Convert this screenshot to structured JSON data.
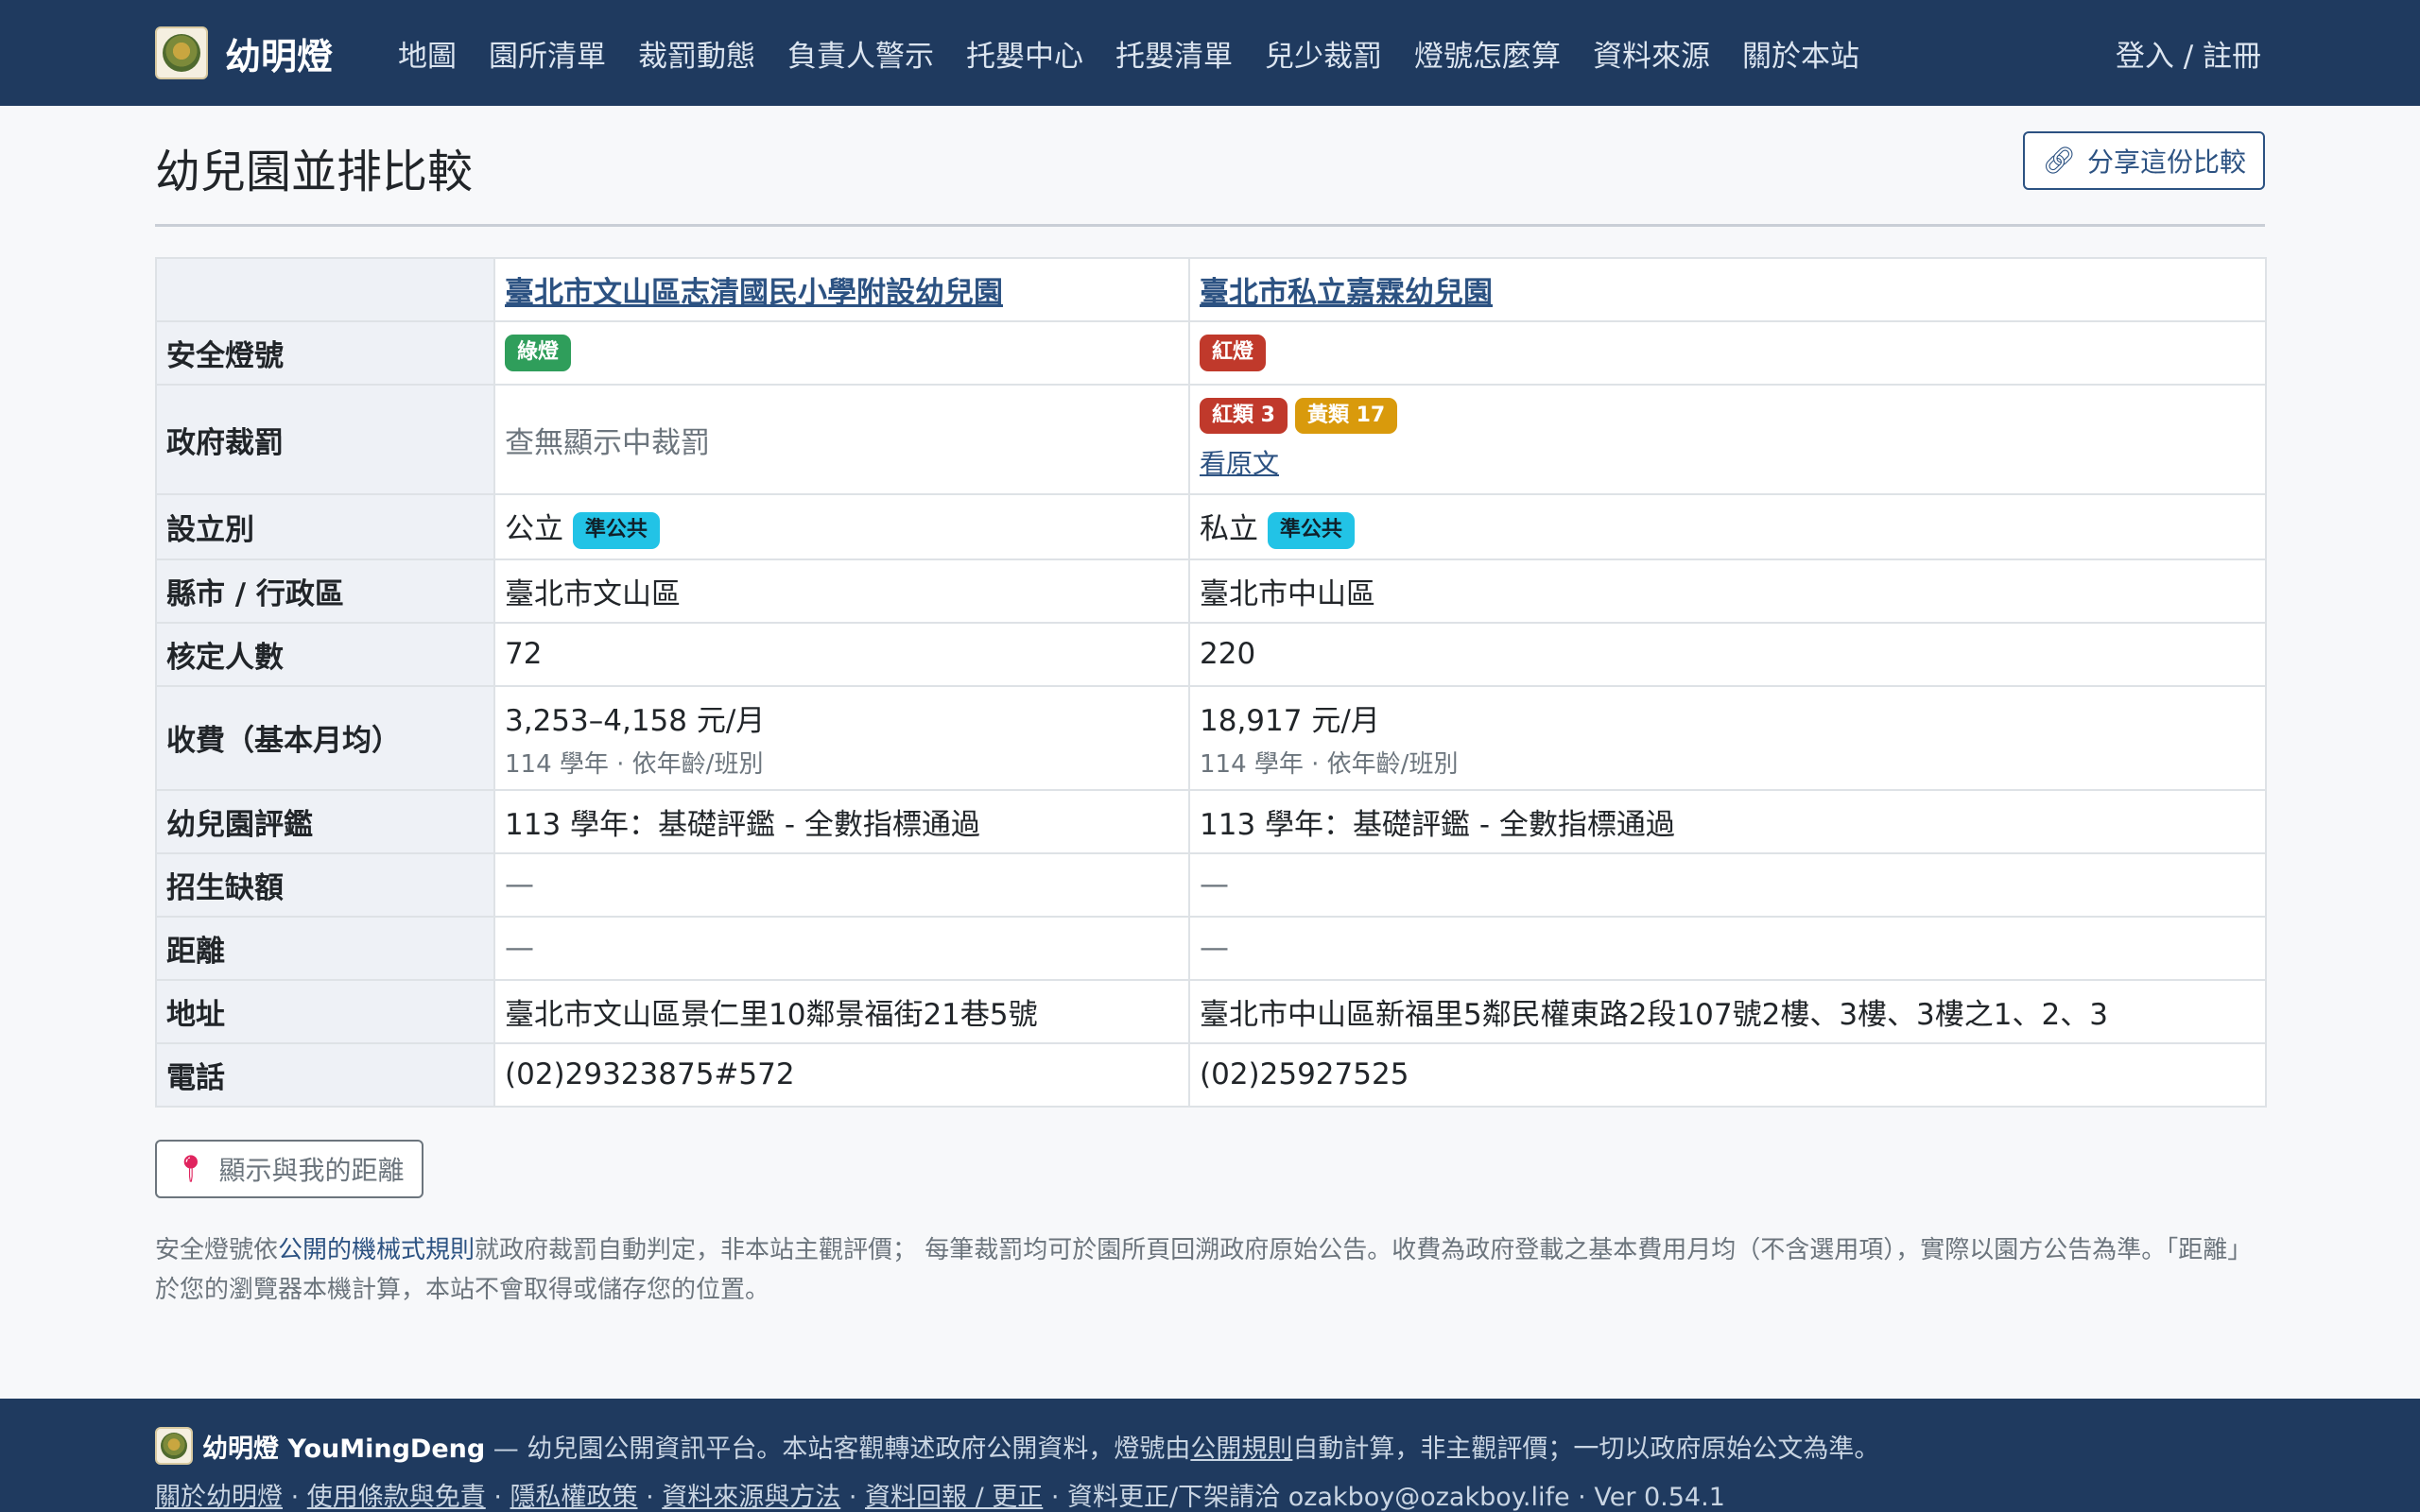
{
  "nav": {
    "brand": "幼明燈",
    "links": [
      "地圖",
      "園所清單",
      "裁罰動態",
      "負責人警示",
      "托嬰中心",
      "托嬰清單",
      "兒少裁罰",
      "燈號怎麼算",
      "資料來源",
      "關於本站"
    ],
    "auth": "登入 / 註冊"
  },
  "page": {
    "title": "幼兒園並排比較",
    "share_label": "分享這份比較",
    "share_icon": "link-icon"
  },
  "compare": {
    "row_labels": {
      "light": "安全燈號",
      "penalty": "政府裁罰",
      "type": "設立別",
      "district": "縣市 / 行政區",
      "capacity": "核定人數",
      "fee": "收費（基本月均）",
      "evaluation": "幼兒園評鑑",
      "vacancy": "招生缺額",
      "distance": "距離",
      "address": "地址",
      "phone": "電話"
    },
    "kg1": {
      "name": "臺北市文山區志清國民小學附設幼兒園",
      "light": "綠燈",
      "light_color": "#2f9e5b",
      "penalty_text": "查無顯示中裁罰",
      "type": "公立",
      "type_badge": "準公共",
      "district": "臺北市文山區",
      "capacity": "72",
      "fee": "3,253–4,158 元/月",
      "fee_note": "114 學年 · 依年齡/班別",
      "evaluation": "113 學年：基礎評鑑 - 全數指標通過",
      "vacancy": "—",
      "distance": "—",
      "address": "臺北市文山區景仁里10鄰景福街21巷5號",
      "phone": "(02)29323875#572"
    },
    "kg2": {
      "name": "臺北市私立嘉霖幼兒園",
      "light": "紅燈",
      "light_color": "#c0392b",
      "penalty_red": "紅類 3",
      "penalty_yellow": "黃類 17",
      "penalty_link": "看原文",
      "type": "私立",
      "type_badge": "準公共",
      "district": "臺北市中山區",
      "capacity": "220",
      "fee": "18,917 元/月",
      "fee_note": "114 學年 · 依年齡/班別",
      "evaluation": "113 學年：基礎評鑑 - 全數指標通過",
      "vacancy": "—",
      "distance": "—",
      "address": "臺北市中山區新福里5鄰民權東路2段107號2樓、3樓、3樓之1、2、3",
      "phone": "(02)25927525"
    }
  },
  "distance_button": {
    "label": "顯示與我的距離",
    "icon": "pin-icon"
  },
  "note": {
    "prefix": "安全燈號依",
    "link": "公開的機械式規則",
    "suffix": "就政府裁罰自動判定，非本站主觀評價； 每筆裁罰均可於園所頁回溯政府原始公告。收費為政府登載之基本費用月均（不含選用項），實際以園方公告為準。「距離」於您的瀏覽器本機計算，本站不會取得或儲存您的位置。"
  },
  "footer": {
    "brand": "幼明燈 YouMingDeng",
    "tagline_a": " — 幼兒園公開資訊平台。本站客觀轉述政府公開資料，燈號由",
    "tagline_link": "公開規則",
    "tagline_b": "自動計算，非主觀評價；一切以政府原始公文為準。",
    "links": [
      "關於幼明燈",
      "使用條款與免責",
      "隱私權政策",
      "資料來源與方法",
      "資料回報 / 更正"
    ],
    "contact": "資料更正/下架請洽 ozakboy@ozakboy.life",
    "version": "Ver 0.54.1",
    "colors": {
      "navbar": "#1f3a5f",
      "accent": "#2c5282"
    }
  }
}
